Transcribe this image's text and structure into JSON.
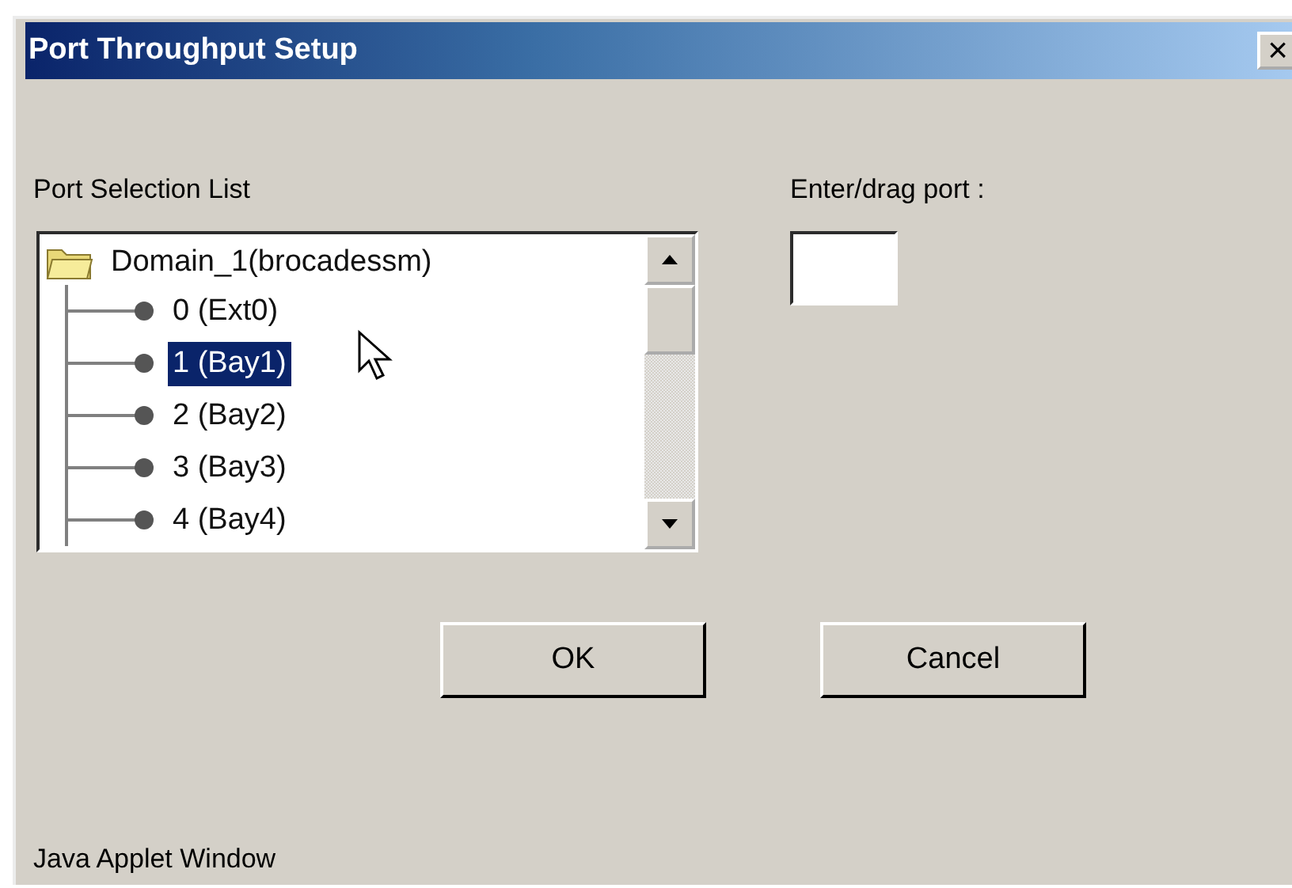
{
  "window": {
    "title": "Port Throughput Setup",
    "close": "×"
  },
  "port_list": {
    "label": "Port Selection List",
    "root": {
      "label": "Domain_1(brocadessm)",
      "expanded": true,
      "children": [
        {
          "label": "0 (Ext0)",
          "selected": false
        },
        {
          "label": "1 (Bay1)",
          "selected": true
        },
        {
          "label": "2 (Bay2)",
          "selected": false
        },
        {
          "label": "3 (Bay3)",
          "selected": false
        },
        {
          "label": "4 (Bay4)",
          "selected": false
        }
      ]
    }
  },
  "port_entry": {
    "label": "Enter/drag port :"
  },
  "buttons": [
    {
      "label": "OK"
    },
    {
      "label": "Cancel"
    }
  ],
  "status_bar": "Java Applet Window"
}
